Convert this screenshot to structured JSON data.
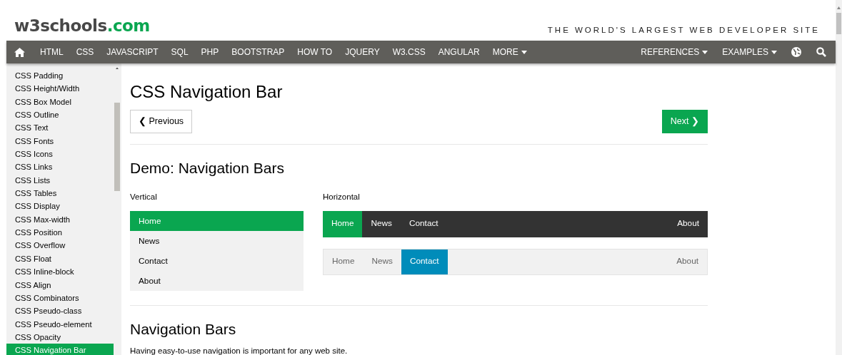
{
  "header": {
    "logo_name": "w3schools",
    "logo_suffix": ".com",
    "tagline": "THE WORLD'S LARGEST WEB DEVELOPER SITE"
  },
  "top_nav": {
    "items": [
      {
        "label": "HTML",
        "dropdown": false
      },
      {
        "label": "CSS",
        "dropdown": false
      },
      {
        "label": "JAVASCRIPT",
        "dropdown": false
      },
      {
        "label": "SQL",
        "dropdown": false
      },
      {
        "label": "PHP",
        "dropdown": false
      },
      {
        "label": "BOOTSTRAP",
        "dropdown": false
      },
      {
        "label": "HOW TO",
        "dropdown": false
      },
      {
        "label": "JQUERY",
        "dropdown": false
      },
      {
        "label": "W3.CSS",
        "dropdown": false
      },
      {
        "label": "ANGULAR",
        "dropdown": false
      },
      {
        "label": "MORE",
        "dropdown": true
      }
    ],
    "right_items": [
      {
        "label": "REFERENCES",
        "dropdown": true
      },
      {
        "label": "EXAMPLES",
        "dropdown": true
      }
    ]
  },
  "sidebar": {
    "items": [
      {
        "label": "CSS Padding",
        "selected": false
      },
      {
        "label": "CSS Height/Width",
        "selected": false
      },
      {
        "label": "CSS Box Model",
        "selected": false
      },
      {
        "label": "CSS Outline",
        "selected": false
      },
      {
        "label": "CSS Text",
        "selected": false
      },
      {
        "label": "CSS Fonts",
        "selected": false
      },
      {
        "label": "CSS Icons",
        "selected": false
      },
      {
        "label": "CSS Links",
        "selected": false
      },
      {
        "label": "CSS Lists",
        "selected": false
      },
      {
        "label": "CSS Tables",
        "selected": false
      },
      {
        "label": "CSS Display",
        "selected": false
      },
      {
        "label": "CSS Max-width",
        "selected": false
      },
      {
        "label": "CSS Position",
        "selected": false
      },
      {
        "label": "CSS Overflow",
        "selected": false
      },
      {
        "label": "CSS Float",
        "selected": false
      },
      {
        "label": "CSS Inline-block",
        "selected": false
      },
      {
        "label": "CSS Align",
        "selected": false
      },
      {
        "label": "CSS Combinators",
        "selected": false
      },
      {
        "label": "CSS Pseudo-class",
        "selected": false
      },
      {
        "label": "CSS Pseudo-element",
        "selected": false
      },
      {
        "label": "CSS Opacity",
        "selected": false
      },
      {
        "label": "CSS Navigation Bar",
        "selected": true
      }
    ]
  },
  "content": {
    "title": "CSS Navigation Bar",
    "prev_button": "❮ Previous",
    "next_button": "Next ❯",
    "demo_heading": "Demo: Navigation Bars",
    "vertical": {
      "label": "Vertical",
      "items": [
        {
          "label": "Home",
          "selected": true
        },
        {
          "label": "News",
          "selected": false
        },
        {
          "label": "Contact",
          "selected": false
        },
        {
          "label": "About",
          "selected": false
        }
      ]
    },
    "horizontal": {
      "label": "Horizontal",
      "bars": [
        {
          "kind": "dark",
          "items": [
            {
              "label": "Home",
              "selected": true
            },
            {
              "label": "News",
              "selected": false
            },
            {
              "label": "Contact",
              "selected": false
            }
          ],
          "right_items": [
            {
              "label": "About",
              "selected": false
            }
          ]
        },
        {
          "kind": "light",
          "items": [
            {
              "label": "Home",
              "selected": false
            },
            {
              "label": "News",
              "selected": false
            },
            {
              "label": "Contact",
              "selected": true
            }
          ],
          "right_items": [
            {
              "label": "About",
              "selected": false
            }
          ]
        }
      ]
    },
    "section_heading": "Navigation Bars",
    "paragraph": "Having easy-to-use navigation is important for any web site."
  }
}
